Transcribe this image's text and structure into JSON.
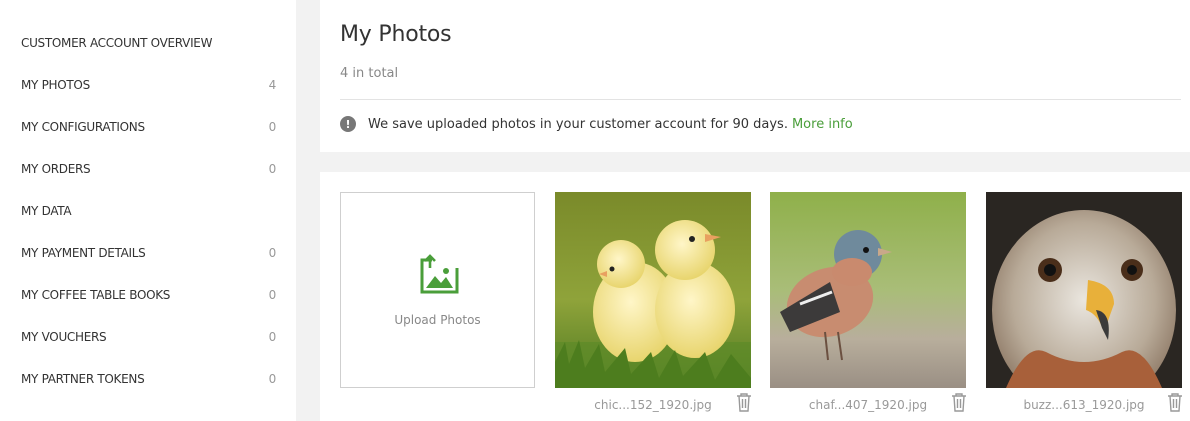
{
  "sidebar": {
    "items": [
      {
        "label": "CUSTOMER ACCOUNT OVERVIEW",
        "count": ""
      },
      {
        "label": "MY PHOTOS",
        "count": "4"
      },
      {
        "label": "MY CONFIGURATIONS",
        "count": "0"
      },
      {
        "label": "MY ORDERS",
        "count": "0"
      },
      {
        "label": "MY DATA",
        "count": ""
      },
      {
        "label": "MY PAYMENT DETAILS",
        "count": "0"
      },
      {
        "label": "MY COFFEE TABLE BOOKS",
        "count": "0"
      },
      {
        "label": "MY VOUCHERS",
        "count": "0"
      },
      {
        "label": "MY PARTNER TOKENS",
        "count": "0"
      }
    ]
  },
  "header": {
    "title": "My Photos",
    "total": "4 in total",
    "notice_icon": "exclamation-icon",
    "notice_text": "We save uploaded photos in your customer account for 90 days.",
    "notice_link": "More info"
  },
  "gallery": {
    "upload_label": "Upload Photos",
    "upload_icon": "image-upload-icon",
    "photos": [
      {
        "caption": "chic...152_1920.jpg",
        "subject": "chicks"
      },
      {
        "caption": "chaf...407_1920.jpg",
        "subject": "chaffinch"
      },
      {
        "caption": "buzz...613_1920.jpg",
        "subject": "buzzard"
      }
    ]
  },
  "colors": {
    "accent": "#4a9e3a",
    "background": "#f2f2f2",
    "panel": "#ffffff"
  }
}
